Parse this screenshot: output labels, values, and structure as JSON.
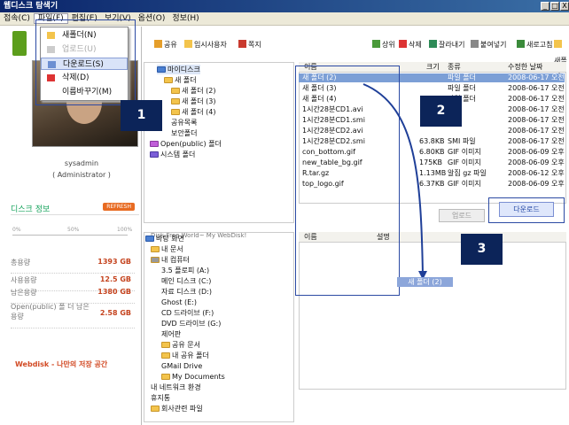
{
  "title": "웹디스크 탐색기",
  "window_buttons": [
    "_",
    "□",
    "X"
  ],
  "menu": [
    "접속(C)",
    "파일(F)",
    "편집(E)",
    "보기(V)",
    "옵션(O)",
    "정보(H)"
  ],
  "dropdown": [
    "새폴더(N)",
    "업로드(U)",
    "다운로드(S)",
    "삭제(D)",
    "이름바꾸기(M)"
  ],
  "profile": {
    "name": "sysadmin",
    "role": "( Administrator )"
  },
  "disk_info": {
    "label": "디스크 정보",
    "button": "REFRESH",
    "scale": [
      "0%",
      "50%",
      "100%"
    ]
  },
  "stats": [
    {
      "label": "총용량",
      "value": "1393 GB"
    },
    {
      "label": "사용용량",
      "value": "12.5 GB"
    },
    {
      "label": "남은용량",
      "value": "1380 GB"
    },
    {
      "label": "Open(public) 폴 더 남은용량",
      "value": "2.58 GB"
    }
  ],
  "brand": "Webdisk - 나만의 저장 공간",
  "top_tools_left": [
    "공유",
    "임시사용자",
    "쪽지"
  ],
  "top_tools_right": [
    "상위",
    "삭제",
    "잘라내기",
    "붙여넣기",
    "새로고침",
    "새폴더"
  ],
  "tree_top": [
    "마이디스크",
    "새 폴더",
    "새 폴더 (2)",
    "새 폴더 (3)",
    "새 폴더 (4)",
    "공유목록",
    "보안폴더",
    "Open(public) 폴더",
    "시스템 폴더"
  ],
  "file_headers": [
    "이름",
    "크기",
    "종류",
    "수정한 날짜"
  ],
  "files": [
    [
      "새 폴더 (2)",
      "",
      "파일 폴더",
      "2008-06-17 오전"
    ],
    [
      "새 폴더 (3)",
      "",
      "파일 폴더",
      "2008-06-17 오전"
    ],
    [
      "새 폴더 (4)",
      "",
      "파일 폴더",
      "2008-06-17 오전"
    ],
    [
      "1시간28분CD1.avi",
      "",
      "",
      "2008-06-17 오전"
    ],
    [
      "1시간28분CD1.smi",
      "",
      "",
      "2008-06-17 오전"
    ],
    [
      "1시간28분CD2.avi",
      "",
      "",
      "2008-06-17 오전"
    ],
    [
      "1시간28분CD2.smi",
      "63.8KB",
      "SMI 파일",
      "2008-06-17 오전"
    ],
    [
      "con_bottom.gif",
      "6.80KB",
      "GIF 이미지",
      "2008-06-09 오후"
    ],
    [
      "new_table_bg.gif",
      "175KB",
      "GIF 이미지",
      "2008-06-09 오후"
    ],
    [
      "R.tar.gz",
      "1.13MB",
      "알집 gz 파일",
      "2008-06-12 오후"
    ],
    [
      "top_logo.gif",
      "6.37KB",
      "GIF 이미지",
      "2008-06-09 오후"
    ]
  ],
  "path": "Disk-Free World~ My WebDisk!",
  "upload_btn": "업로드",
  "download_btn": "다운로드",
  "lower_header": [
    "이름",
    "설명"
  ],
  "lower_tree": [
    "바탕 화면",
    "내 문서",
    "내 컴퓨터",
    "3.5 플로피 (A:)",
    "메인 디스크 (C:)",
    "자료 디스크 (D:)",
    "Ghost (E:)",
    "CD 드라이브 (F:)",
    "DVD 드라이브 (G:)",
    "제어판",
    "공유 문서",
    "내 공유 폴더",
    "GMail Drive",
    "My Documents",
    "내 네트워크 환경",
    "휴지통",
    "회사관련 파일"
  ],
  "drag_label": "새 폴더 (2)",
  "callouts": [
    "1",
    "2",
    "3"
  ]
}
